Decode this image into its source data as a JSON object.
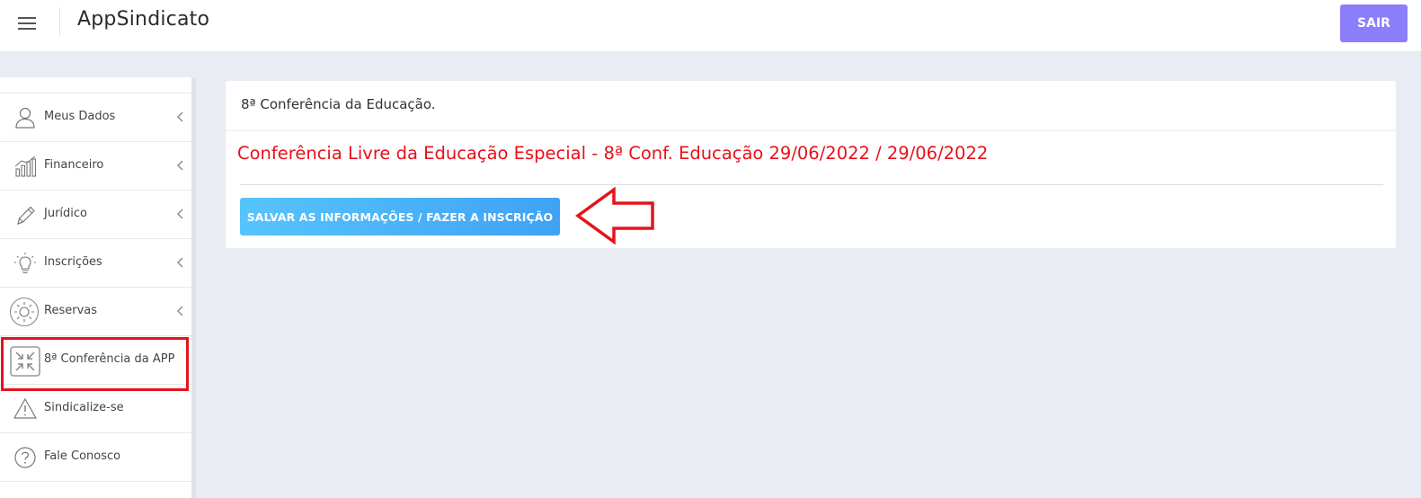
{
  "header": {
    "app_title": "AppSindicato",
    "logout_label": "SAIR"
  },
  "sidebar": {
    "items": [
      {
        "label": "Meus Dados",
        "icon": "user-icon"
      },
      {
        "label": "Financeiro",
        "icon": "bar-chart-icon"
      },
      {
        "label": "Jurídico",
        "icon": "pencil-icon"
      },
      {
        "label": "Inscrições",
        "icon": "lightbulb-icon"
      },
      {
        "label": "Reservas",
        "icon": "sun-icon"
      },
      {
        "label": "8ª Conferência da APP",
        "icon": "compress-icon",
        "highlighted": true
      },
      {
        "label": "Sindicalize-se",
        "icon": "warning-icon"
      },
      {
        "label": "Fale Conosco",
        "icon": "question-icon"
      }
    ]
  },
  "main": {
    "card_title": "8ª Conferência da Educação.",
    "event_title": "Conferência Livre da Educação Especial - 8ª Conf. Educação 29/06/2022 / 29/06/2022",
    "save_button_label": "SALVAR AS INFORMAÇÕES / FAZER A INSCRIÇÃO"
  },
  "colors": {
    "accent_purple": "#8c7dfb",
    "event_red": "#e8101a",
    "button_blue": "#4fb6f9",
    "highlight_red": "#e4141c",
    "background": "#e9ecf3"
  }
}
